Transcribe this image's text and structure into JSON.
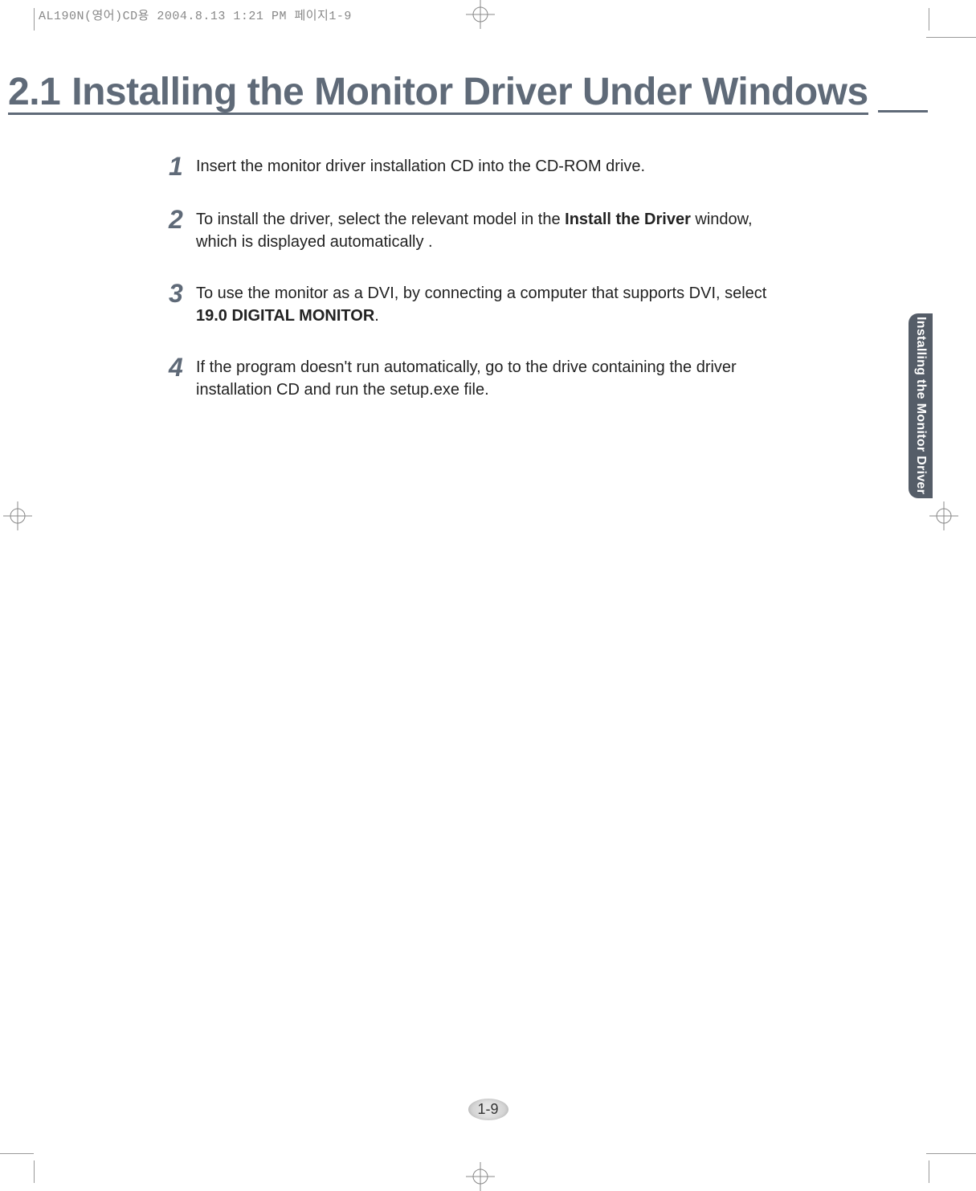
{
  "print_header": "AL190N(영어)CD용 2004.8.13 1:21 PM 페이지1-9",
  "heading": {
    "number": "2.1",
    "title": "Installing the Monitor Driver Under Windows"
  },
  "steps": [
    {
      "n": "1",
      "text_pre": "Insert the monitor driver installation CD into the CD-ROM drive.",
      "bold": "",
      "text_post": ""
    },
    {
      "n": "2",
      "text_pre": "To install the driver, select the relevant model in the ",
      "bold": "Install the Driver",
      "text_post": " window, which is displayed automatically ."
    },
    {
      "n": "3",
      "text_pre": "To use the monitor as a DVI, by connecting a computer that supports DVI, select ",
      "bold": "19.0 DIGITAL MONITOR",
      "text_post": "."
    },
    {
      "n": "4",
      "text_pre": "If the program doesn't run automatically, go to the drive containing the driver installation CD and run the setup.exe file.",
      "bold": "",
      "text_post": ""
    }
  ],
  "side_tab": "Installing the Monitor Driver",
  "page_number": "1-9"
}
